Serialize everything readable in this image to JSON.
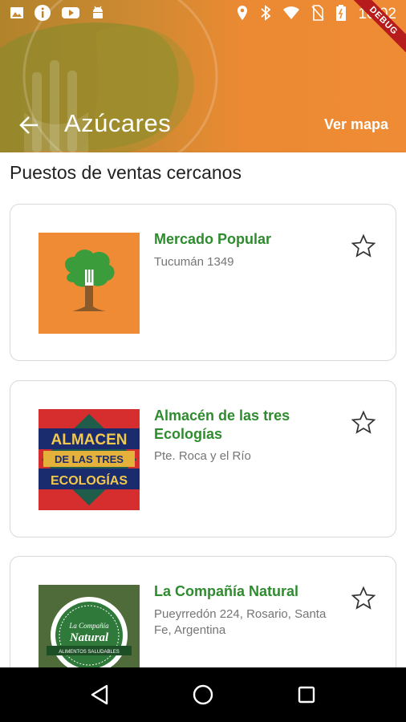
{
  "status_bar": {
    "time": "10:02",
    "left_icons": [
      "image-icon",
      "info-icon",
      "youtube-icon",
      "android-icon"
    ],
    "right_icons": [
      "location-icon",
      "bluetooth-icon",
      "wifi-icon",
      "no-sim-icon",
      "battery-icon"
    ]
  },
  "app_bar": {
    "title": "Azúcares",
    "action_label": "Ver mapa",
    "debug_banner": "DEBUG"
  },
  "section": {
    "title": "Puestos de ventas cercanos"
  },
  "stores": [
    {
      "name": "Mercado Popular",
      "address": "Tucumán 1349",
      "favorite": false,
      "thumb": "tree-fork-logo"
    },
    {
      "name": "Almacén de las tres Ecologías",
      "address": "Pte. Roca y el Río",
      "favorite": false,
      "thumb": "almacen-logo",
      "logo_text": [
        "ALMACEN",
        "DE LAS TRES",
        "ECOLOGÍAS"
      ]
    },
    {
      "name": "La Compañía Natural",
      "address": "Pueyrredón 224, Rosario, Santa Fe, Argentina",
      "favorite": false,
      "thumb": "compania-natural-logo",
      "logo_text": [
        "La Compañía",
        "Natural",
        "ALIMENTOS SALUDABLES"
      ]
    }
  ],
  "colors": {
    "accent_orange": "#ef8b35",
    "store_name_green": "#2e8b2e",
    "address_grey": "#757575"
  }
}
